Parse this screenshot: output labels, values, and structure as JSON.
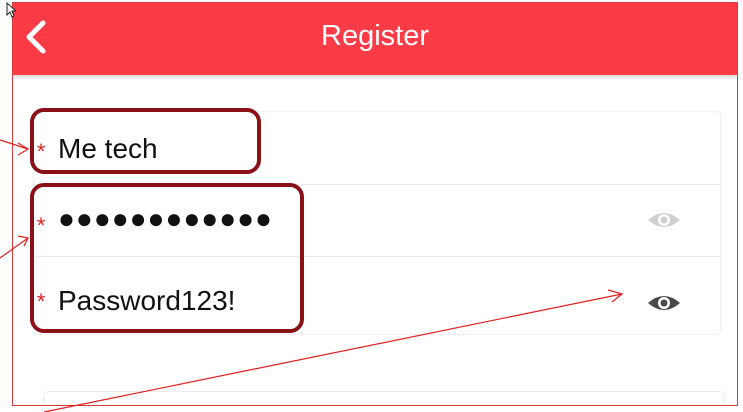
{
  "header": {
    "title": "Register",
    "background_color": "#fb3b46",
    "back_icon": "chevron-left-icon"
  },
  "form": {
    "required_marker": "*",
    "fields": [
      {
        "id": "username",
        "value": "Me tech"
      },
      {
        "id": "password",
        "value": "●●●●●●●●●●●●",
        "masked": true,
        "toggle_icon": "eye-icon",
        "toggle_state": "hidden"
      },
      {
        "id": "confirm-password",
        "value": "Password123!",
        "masked": false,
        "toggle_icon": "eye-icon",
        "toggle_state": "visible"
      }
    ]
  },
  "annotations": {
    "highlight_color": "#8b1118",
    "arrow_color": "#e02020"
  }
}
